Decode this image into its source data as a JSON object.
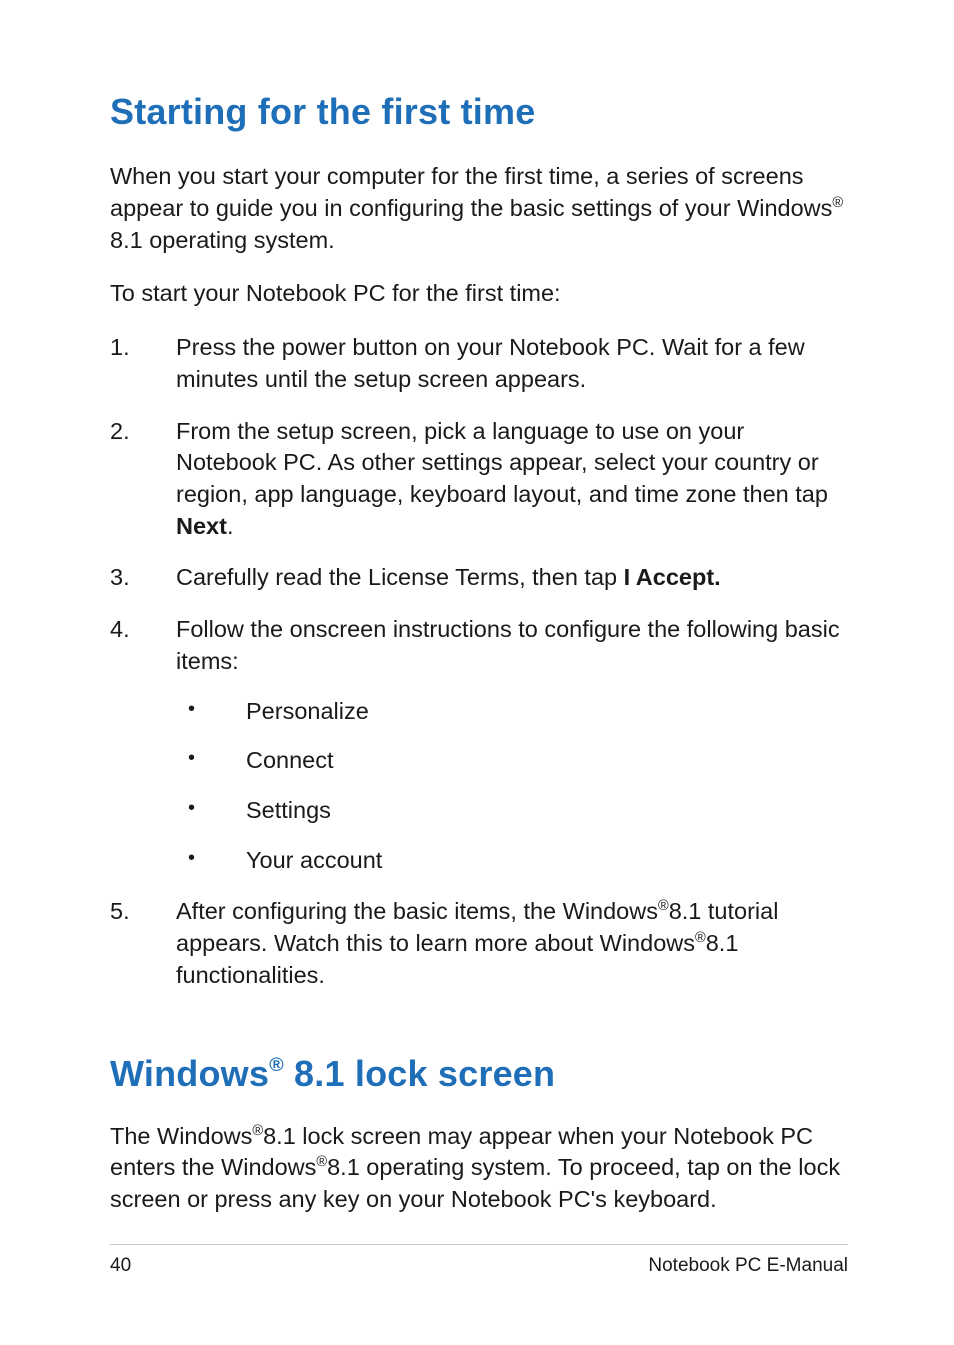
{
  "heading1": {
    "text": "Starting for the first time"
  },
  "intro": {
    "p1_a": "When you start your computer for the first time, a series of screens appear to guide you in configuring the basic settings of your Windows",
    "p1_reg": "®",
    "p1_b": " 8.1 operating system.",
    "p2": "To start your Notebook PC for the first time:"
  },
  "steps": {
    "s1": "Press the power button on your Notebook PC. Wait for a few minutes until the setup screen appears.",
    "s2_a": "From the setup screen, pick a language to use on your Notebook PC. As other settings appear, select your country or region, app language, keyboard layout, and time zone then tap ",
    "s2_bold": "Next",
    "s2_b": ".",
    "s3_a": "Carefully read the License Terms, then tap ",
    "s3_bold": "I Accept.",
    "s4": "Follow the onscreen instructions to configure the following basic items:",
    "s4_items": {
      "i1": "Personalize",
      "i2": "Connect",
      "i3": "Settings",
      "i4": "Your account"
    },
    "s5_a": "After configuring the basic items, the Windows",
    "s5_reg1": "®",
    "s5_b": "8.1 tutorial appears. Watch this to learn more about Windows",
    "s5_reg2": "®",
    "s5_c": "8.1 functionalities."
  },
  "heading2": {
    "pre": "Windows",
    "sup": "®",
    "post": " 8.1 lock screen"
  },
  "lockscreen": {
    "a": "The Windows",
    "reg1": "®",
    "b": "8.1 lock screen may appear when your Notebook PC enters the Windows",
    "reg2": "®",
    "c": "8.1 operating system. To proceed,  tap on the lock screen or press any key on your Notebook PC's keyboard."
  },
  "footer": {
    "page": "40",
    "title": "Notebook PC E-Manual"
  }
}
